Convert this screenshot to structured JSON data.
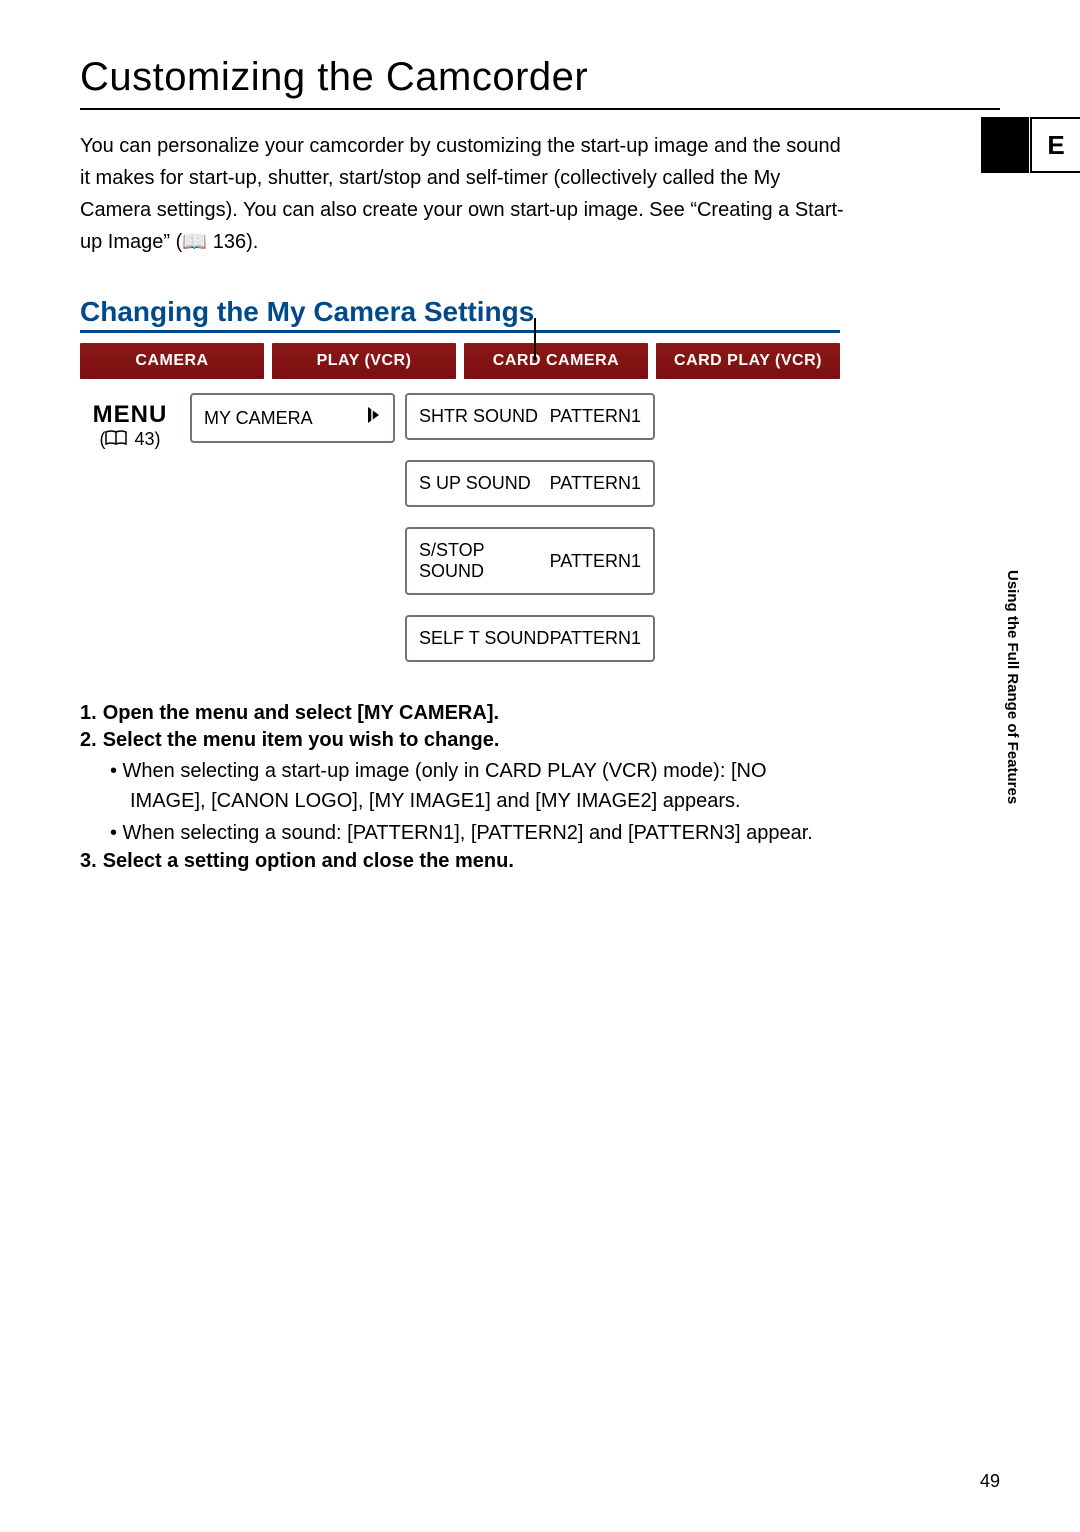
{
  "title": "Customizing the Camcorder",
  "intro": "You can personalize your camcorder by customizing the start-up image and the sound it makes for start-up, shutter, start/stop and self-timer (collectively called the My Camera settings). You can also create your own start-up image. See “Creating a Start-up Image” (📖 136).",
  "e_tab": "E",
  "section_heading": "Changing the My Camera Settings",
  "modes": [
    "CAMERA",
    "PLAY (VCR)",
    "CARD CAMERA",
    "CARD PLAY (VCR)"
  ],
  "menu": {
    "label": "MENU",
    "page_ref": "43",
    "col1": "MY CAMERA",
    "items": [
      {
        "name": "SHTR SOUND",
        "value": "PATTERN1"
      },
      {
        "name": "S UP SOUND",
        "value": "PATTERN1"
      },
      {
        "name": "S/STOP SOUND",
        "value": "PATTERN1"
      },
      {
        "name": "SELF T SOUND",
        "value": "PATTERN1"
      }
    ]
  },
  "steps": {
    "s1": {
      "num": "1.",
      "text": "Open the menu and select [MY CAMERA]."
    },
    "s2": {
      "num": "2.",
      "text": "Select the menu item you wish to change."
    },
    "s2a": "• When selecting a start-up image (only in CARD PLAY (VCR) mode): [NO IMAGE], [CANON LOGO], [MY IMAGE1] and [MY IMAGE2] appears.",
    "s2b": "• When selecting a sound: [PATTERN1], [PATTERN2] and [PATTERN3] appear.",
    "s3": {
      "num": "3.",
      "text": "Select a setting option and close the menu."
    }
  },
  "side_text": "Using the Full Range of Features",
  "page_number": "49"
}
